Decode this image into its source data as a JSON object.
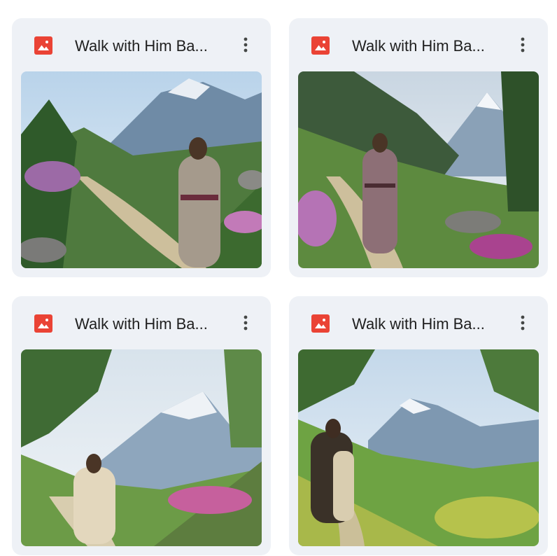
{
  "files": [
    {
      "title": "Walk with Him Ba...",
      "icon": "image-file-icon",
      "accent": "#ea4335"
    },
    {
      "title": "Walk with Him Ba...",
      "icon": "image-file-icon",
      "accent": "#ea4335"
    },
    {
      "title": "Walk with Him Ba...",
      "icon": "image-file-icon",
      "accent": "#ea4335"
    },
    {
      "title": "Walk with Him Ba...",
      "icon": "image-file-icon",
      "accent": "#ea4335"
    }
  ]
}
